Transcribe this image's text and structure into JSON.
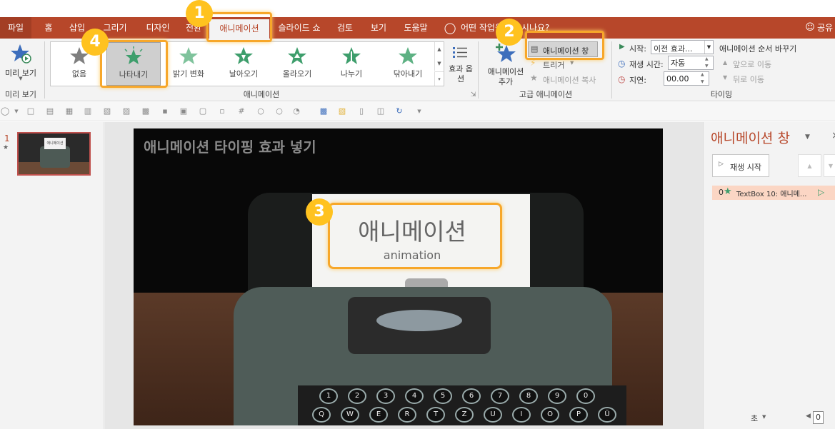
{
  "tabs": {
    "file": "파일",
    "home": "홈",
    "insert": "삽입",
    "draw": "그리기",
    "design": "디자인",
    "transitions": "전환",
    "animations": "애니메이션",
    "slideshow": "슬라이드 쇼",
    "review": "검토",
    "view": "보기",
    "help": "도움말",
    "tellme": "어떤 작업을 원하시나요?",
    "share": "공유"
  },
  "preview": {
    "label": "미리 보기",
    "group": "미리 보기"
  },
  "gallery": {
    "items": [
      "없음",
      "나타내기",
      "밝기 변화",
      "날아오기",
      "올라오기",
      "나누기",
      "닦아내기"
    ],
    "effect_options": "효과 옵션",
    "group": "애니메이션"
  },
  "advanced": {
    "add_animation": "애니메이션 추가",
    "pane_button": "애니메이션 창",
    "trigger": "트리거",
    "painter": "애니메이션 복사",
    "group": "고급 애니메이션"
  },
  "timing": {
    "start_label": "시작:",
    "start_value": "이전 효과...",
    "duration_label": "재생 시간:",
    "duration_value": "자동",
    "delay_label": "지연:",
    "delay_value": "00.00",
    "reorder": "애니메이션 순서 바꾸기",
    "move_earlier": "앞으로 이동",
    "move_later": "뒤로 이동",
    "group": "타이밍"
  },
  "thumbs": {
    "slide_number": "1",
    "thumb_text": "애니메이션"
  },
  "slide": {
    "title": "애니메이션 타이핑 효과 넣기",
    "paper_main": "애니메이션",
    "paper_sub": "animation",
    "keys_row1": [
      "1",
      "2",
      "3",
      "4",
      "5",
      "6",
      "7",
      "8",
      "9",
      "0"
    ],
    "keys_row2": [
      "Q",
      "W",
      "E",
      "R",
      "T",
      "Z",
      "U",
      "I",
      "O",
      "P",
      "Ü"
    ],
    "keys_symbols": [
      "!",
      "\"",
      "§",
      "$",
      "%",
      "&",
      "/",
      "(",
      ")",
      "="
    ]
  },
  "anim_pane": {
    "title": "애니메이션 창",
    "play": "재생 시작",
    "item_index": "0",
    "item_label": "TextBox 10: 애니메...",
    "unit": "초",
    "page": "0"
  },
  "badges": [
    "1",
    "2",
    "3",
    "4"
  ],
  "colors": {
    "accent": "#b7472a",
    "callout": "#f7a72a",
    "badge": "#ffc21f",
    "star": "#3e9e6c"
  }
}
